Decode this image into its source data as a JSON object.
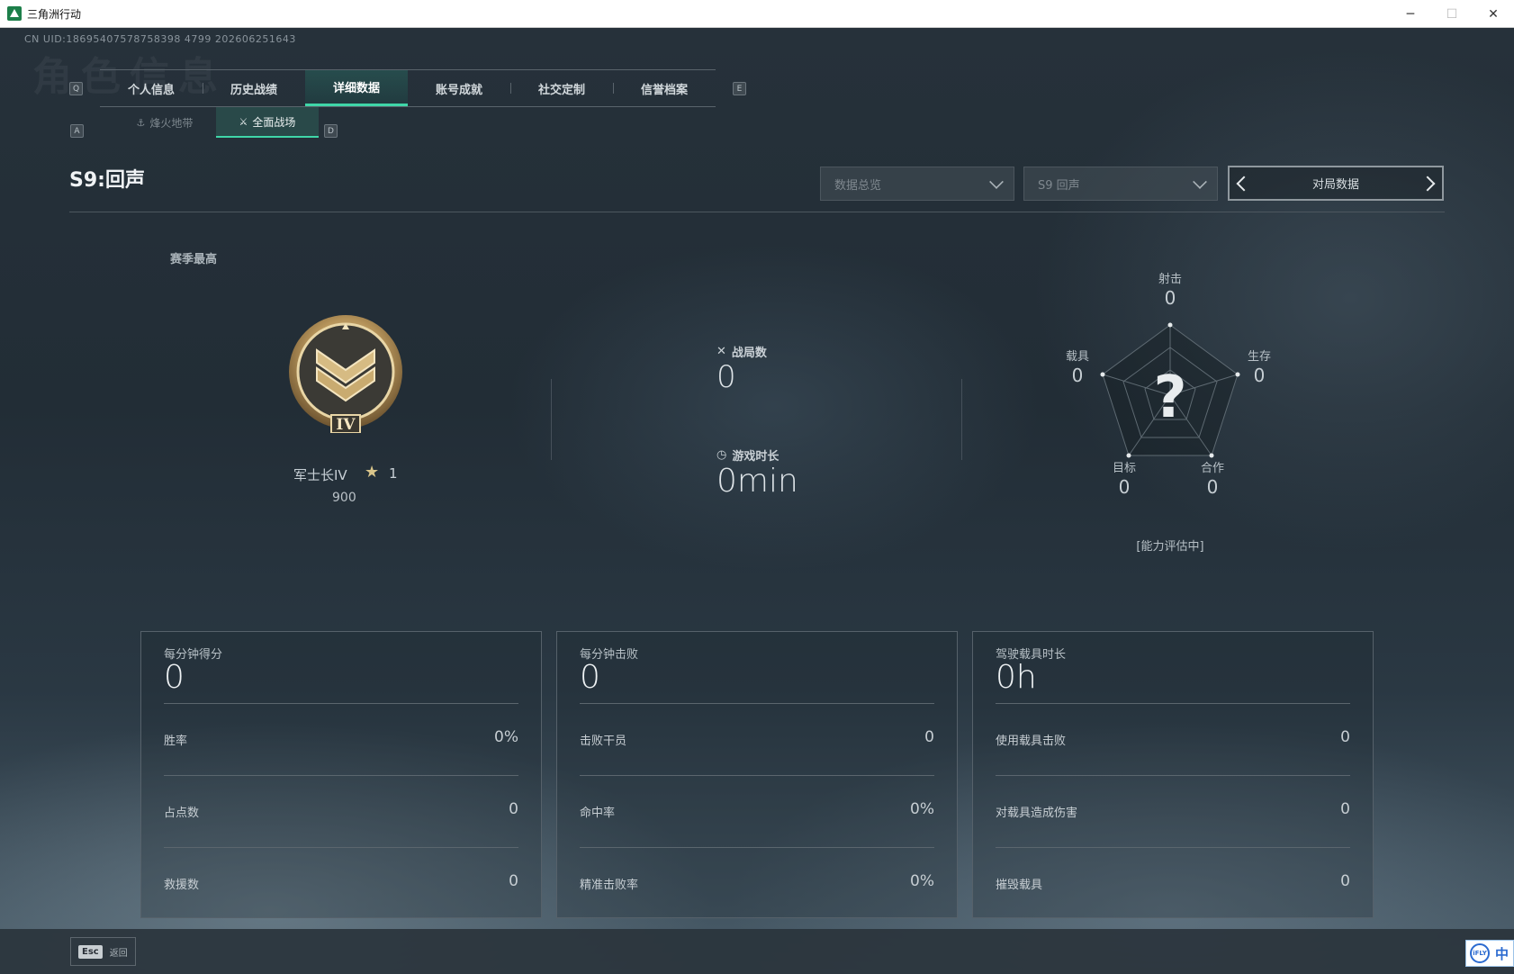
{
  "window": {
    "title": "三角洲行动",
    "minimize": "─",
    "maximize": "☐",
    "close": "✕"
  },
  "uid": "CN UID:18695407578758398 4799 202606251643",
  "watermark": "角色信息",
  "tabs": {
    "left_key": "Q",
    "right_key": "E",
    "items": [
      "个人信息",
      "历史战绩",
      "详细数据",
      "账号成就",
      "社交定制",
      "信誉档案"
    ],
    "active_index": 2
  },
  "subtabs": {
    "left_key": "A",
    "right_key": "D",
    "items": [
      {
        "icon": "⚓",
        "label": "烽火地带"
      },
      {
        "icon": "⚔",
        "label": "全面战场"
      }
    ],
    "active_index": 1
  },
  "season": {
    "title": "S9:回声"
  },
  "filters": {
    "data_overview": "数据总览",
    "season_select": "S9 回声",
    "pager_label": "对局数据"
  },
  "rank": {
    "section_label": "赛季最高",
    "name": "军士长IV",
    "star_icon": "★",
    "stars": "1",
    "points": "900",
    "medal_numeral": "IV"
  },
  "stats": {
    "matches_label": "战局数",
    "matches_value": "0",
    "playtime_label": "游戏时长",
    "playtime_value": "0min"
  },
  "radar": {
    "center_symbol": "?",
    "status": "[能力评估中]",
    "axes": [
      {
        "label": "射击",
        "value": "0"
      },
      {
        "label": "生存",
        "value": "0"
      },
      {
        "label": "合作",
        "value": "0"
      },
      {
        "label": "目标",
        "value": "0"
      },
      {
        "label": "载具",
        "value": "0"
      }
    ]
  },
  "cards": [
    {
      "head": "每分钟得分",
      "main": "0",
      "rows": [
        {
          "label": "胜率",
          "value": "0%"
        },
        {
          "label": "占点数",
          "value": "0"
        },
        {
          "label": "救援数",
          "value": "0"
        }
      ]
    },
    {
      "head": "每分钟击败",
      "main": "0",
      "rows": [
        {
          "label": "击败干员",
          "value": "0"
        },
        {
          "label": "命中率",
          "value": "0%"
        },
        {
          "label": "精准击败率",
          "value": "0%"
        }
      ]
    },
    {
      "head": "驾驶载具时长",
      "main": "0h",
      "rows": [
        {
          "label": "使用载具击败",
          "value": "0"
        },
        {
          "label": "对载具造成伤害",
          "value": "0"
        },
        {
          "label": "摧毁载具",
          "value": "0"
        }
      ]
    }
  ],
  "footer": {
    "esc_key": "Esc",
    "back_label": "返回",
    "ime_logo": "iFLY",
    "ime_char": "中"
  },
  "colors": {
    "accent": "#3fd6a8",
    "background": "#26313a"
  }
}
